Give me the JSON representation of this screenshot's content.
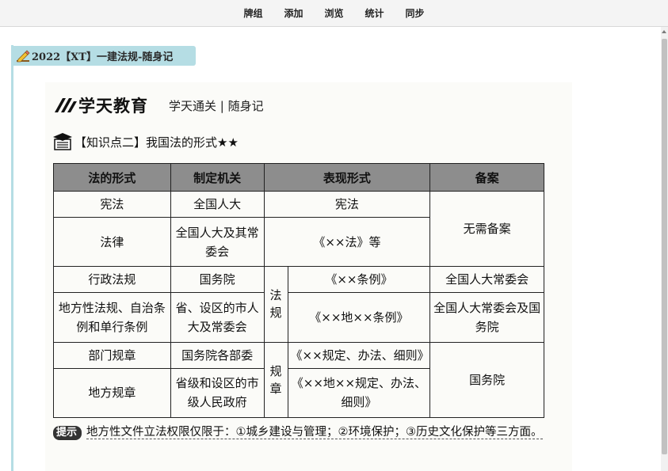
{
  "nav": {
    "items": [
      "牌组",
      "添加",
      "浏览",
      "统计",
      "同步"
    ]
  },
  "deck": {
    "title": "2022【XT】一建法规-随身记",
    "icon": "pencil-icon"
  },
  "card": {
    "brand": "学天教育",
    "brand_sub": "学天通关 | 随身记",
    "section_title": "【知识点二】我国法的形式★★",
    "table": {
      "headers": [
        "法的形式",
        "制定机关",
        "表现形式",
        "备案"
      ],
      "rows": [
        {
          "form": "宪法",
          "organ": "全国人大",
          "expr": "宪法"
        },
        {
          "form": "法律",
          "organ": "全国人大及其常委会",
          "expr": "《××法》等"
        },
        {
          "form": "行政法规",
          "organ": "国务院",
          "expr": "《××条例》",
          "record": "全国人大常委会"
        },
        {
          "form": "地方性法规、自治条例和单行条例",
          "organ": "省、设区的市人大及常委会",
          "expr": "《××地××条例》",
          "record": "全国人大常委会及国务院"
        },
        {
          "form": "部门规章",
          "organ": "国务院各部委",
          "expr": "《××规定、办法、细则》"
        },
        {
          "form": "地方规章",
          "organ": "省级和设区的市级人民政府",
          "expr": "《××地××规定、办法、细则》"
        }
      ],
      "group_fagui": "法规",
      "group_guizhang": "规章",
      "record_none": "无需备案",
      "record_guowuyuan": "国务院"
    },
    "tip_badge": "提示",
    "tip_text": "地方性文件立法权限仅限于：①城乡建设与管理；②环境保护；③历史文化保护等三方面。"
  },
  "colors": {
    "accent": "#b5dde4",
    "header_gray": "#8d8d8d"
  }
}
